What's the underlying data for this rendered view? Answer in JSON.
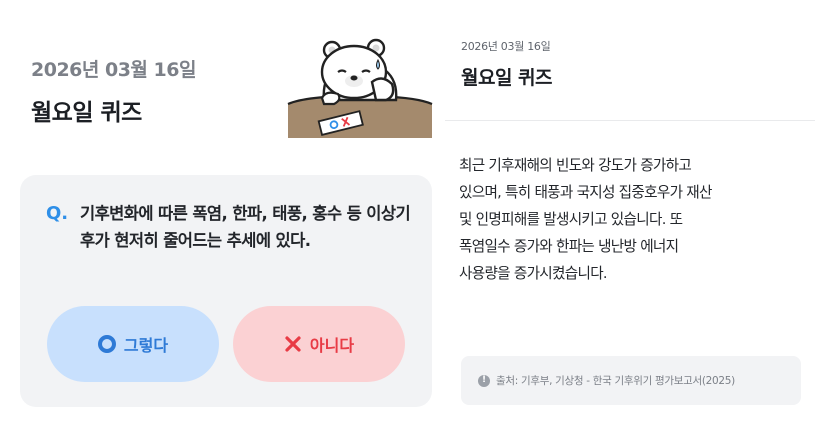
{
  "quiz": {
    "date": "2026년 03월 16일",
    "title": "월요일 퀴즈",
    "mascot_icon": "polar-bear-mascot",
    "question_prefix": "Q.",
    "question": "기후변화에 따른 폭염, 한파, 태풍, 홍수 등 이상기후가 현저히 줄어드는 추세에 있다.",
    "answers": {
      "yes_label": "그렇다",
      "no_label": "아니다"
    },
    "colors": {
      "accent_blue": "#2f8fe8",
      "yes_bg": "#c8e0fd",
      "no_bg": "#fbd1d3",
      "no_text": "#e83b45"
    }
  },
  "explanation": {
    "date": "2026년 03월 16일",
    "title": "월요일 퀴즈",
    "body": "최근 기후재해의 빈도와 강도가 증가하고\n있으며, 특히 태풍과 국지성 집중호우가 재산\n및 인명피해를 발생시키고 있습니다. 또\n폭염일수 증가와 한파는 냉난방 에너지\n사용량을 증가시켰습니다.",
    "source": "출처: 기후부, 기상청 - 한국 기후위기 평가보고서(2025)",
    "source_icon": "info-icon"
  }
}
